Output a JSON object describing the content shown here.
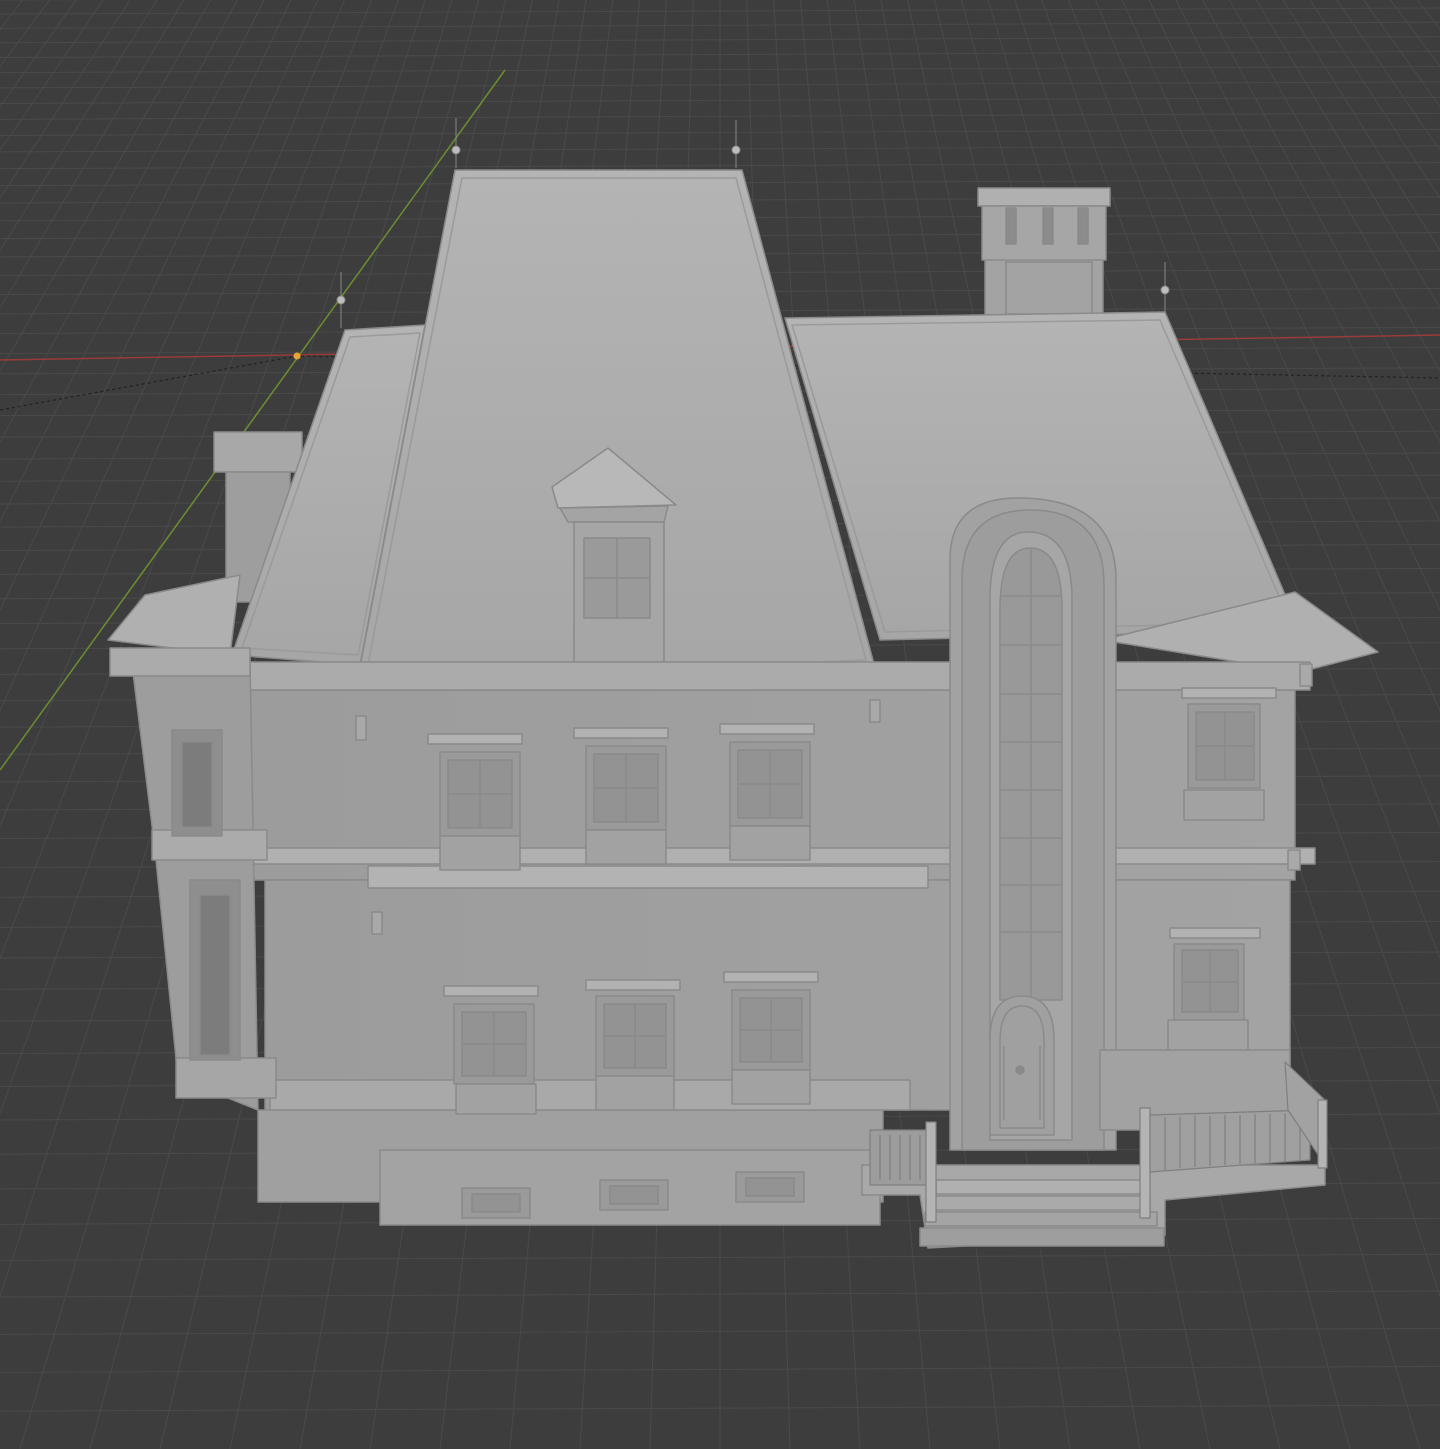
{
  "app": {
    "title": "",
    "view": "3D Viewport"
  },
  "viewport": {
    "background": "#3d3d3d",
    "grid_color": "#4a4a4a",
    "x_axis_color": "#9b3a3a",
    "y_axis_color": "#6b8f2e",
    "origin_marker_color": "#e8a33a",
    "mesh_color": "#a8a8a8",
    "mesh_edge_color": "#8e8e8e",
    "overlays": {
      "grid": true,
      "axis_x": true,
      "axis_y": true,
      "selection_outline": "dashed"
    }
  },
  "model": {
    "name": "",
    "type": "mesh-solid",
    "description_parts": [
      "mansard-roof",
      "dormer-window",
      "chimney",
      "arched-tower-window",
      "front-door",
      "porch-railing",
      "entry-steps",
      "bay-window"
    ]
  }
}
